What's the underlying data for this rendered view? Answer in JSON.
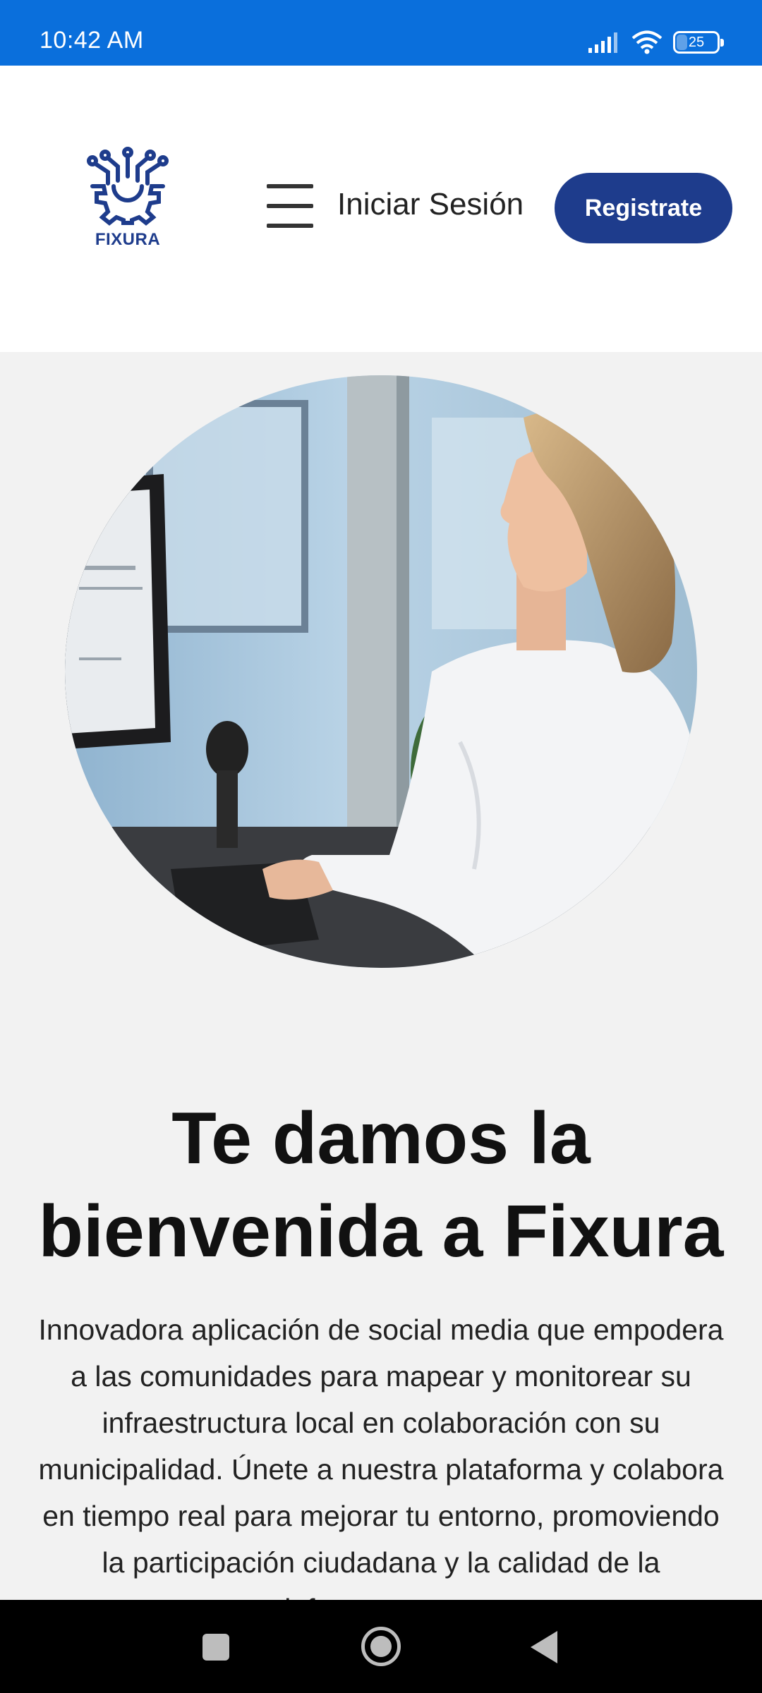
{
  "status_bar": {
    "time": "10:42 AM",
    "battery": "25",
    "icons": [
      "signal-icon",
      "wifi-icon",
      "battery-icon"
    ]
  },
  "header": {
    "logo_text": "FIXURA",
    "login_label": "Iniciar Sesión",
    "register_label": "Registrate",
    "menu_icon": "hamburger-menu-icon"
  },
  "hero": {
    "title_part1": "Te damos la bienvenida a ",
    "title_brand": "Fixura",
    "description": "Innovadora aplicación de social media que empodera a las comunidades para mapear y monitorear su infraestructura local en colaboración con su municipalidad. Únete a nuestra plataforma y colabora en tiempo real para mejorar tu entorno, promoviendo la participación ciudadana y la calidad de la infraestructura."
  },
  "nav_bar": {
    "icons": [
      "recents-icon",
      "home-icon",
      "back-icon"
    ]
  },
  "colors": {
    "status_bar": "#0a6fdc",
    "brand": "#1e3c8c",
    "background": "#f2f2f2"
  }
}
